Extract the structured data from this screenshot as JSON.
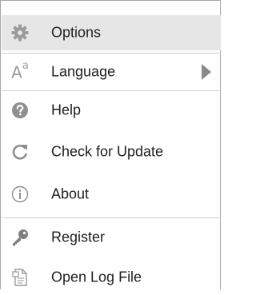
{
  "menu": {
    "items": [
      {
        "label": "Options",
        "icon": "gear-icon"
      },
      {
        "label": "Language",
        "icon": "language-icon"
      },
      {
        "label": "Help",
        "icon": "help-icon"
      },
      {
        "label": "Check for Update",
        "icon": "refresh-icon"
      },
      {
        "label": "About",
        "icon": "info-icon"
      },
      {
        "label": "Register",
        "icon": "key-icon"
      },
      {
        "label": "Open Log File",
        "icon": "log-file-icon"
      }
    ],
    "language_glyph": "A",
    "language_glyph_sup": "a"
  },
  "colors": {
    "highlight": "#e6e6e6",
    "icon": "#9a9a9a",
    "text": "#1e1e1e",
    "border": "#a7a7a7"
  }
}
